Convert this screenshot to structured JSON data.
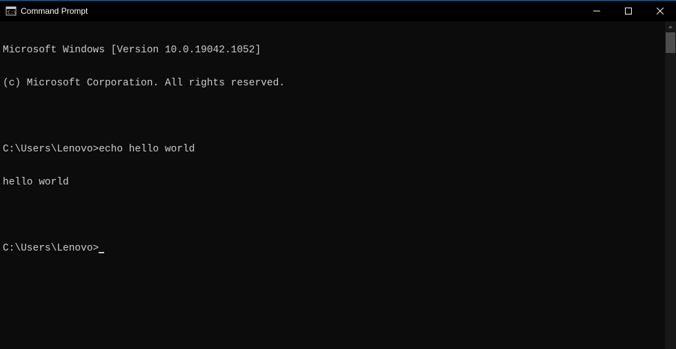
{
  "window": {
    "title": "Command Prompt"
  },
  "terminal": {
    "lines": [
      "Microsoft Windows [Version 10.0.19042.1052]",
      "(c) Microsoft Corporation. All rights reserved.",
      "",
      "C:\\Users\\Lenovo>echo hello world",
      "hello world",
      "",
      "C:\\Users\\Lenovo>"
    ],
    "version_line": "Microsoft Windows [Version 10.0.19042.1052]",
    "copyright_line": "(c) Microsoft Corporation. All rights reserved.",
    "prompt1": "C:\\Users\\Lenovo>",
    "command1": "echo hello world",
    "output1": "hello world",
    "prompt2": "C:\\Users\\Lenovo>"
  }
}
